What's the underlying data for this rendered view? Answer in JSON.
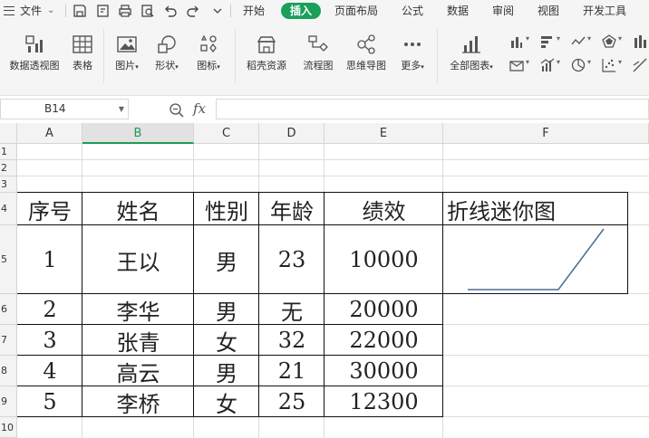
{
  "menubar": {
    "file_label": "文件",
    "tabs": [
      "开始",
      "插入",
      "页面布局",
      "公式",
      "数据",
      "审阅",
      "视图",
      "开发工具"
    ],
    "active_tab": "插入"
  },
  "ribbon": {
    "pivot_table": "数据透视图",
    "table": "表格",
    "picture": "图片",
    "shape": "形状",
    "icon": "图标",
    "docer_resources": "稻壳资源",
    "flowchart": "流程图",
    "mindmap": "思维导图",
    "more": "更多",
    "all_charts": "全部图表"
  },
  "formula_bar": {
    "name_box": "B14",
    "fx_label": "fx",
    "formula_value": ""
  },
  "grid": {
    "columns": [
      "A",
      "B",
      "C",
      "D",
      "E",
      "F"
    ],
    "selected_column": "B",
    "rows": [
      "1",
      "2",
      "3",
      "4",
      "5",
      "6",
      "7",
      "8",
      "9",
      "10"
    ]
  },
  "table": {
    "headers": [
      "序号",
      "姓名",
      "性别",
      "年龄",
      "绩效",
      "折线迷你图"
    ],
    "rows": [
      [
        "1",
        "王以",
        "男",
        "23",
        "10000"
      ],
      [
        "2",
        "李华",
        "男",
        "无",
        "20000"
      ],
      [
        "3",
        "张青",
        "女",
        "32",
        "22000"
      ],
      [
        "4",
        "高云",
        "男",
        "21",
        "30000"
      ],
      [
        "5",
        "李桥",
        "女",
        "25",
        "12300"
      ]
    ]
  },
  "sparkline": {
    "type": "line",
    "values": [
      0,
      0,
      0,
      1
    ],
    "color": "#4a6f96"
  }
}
